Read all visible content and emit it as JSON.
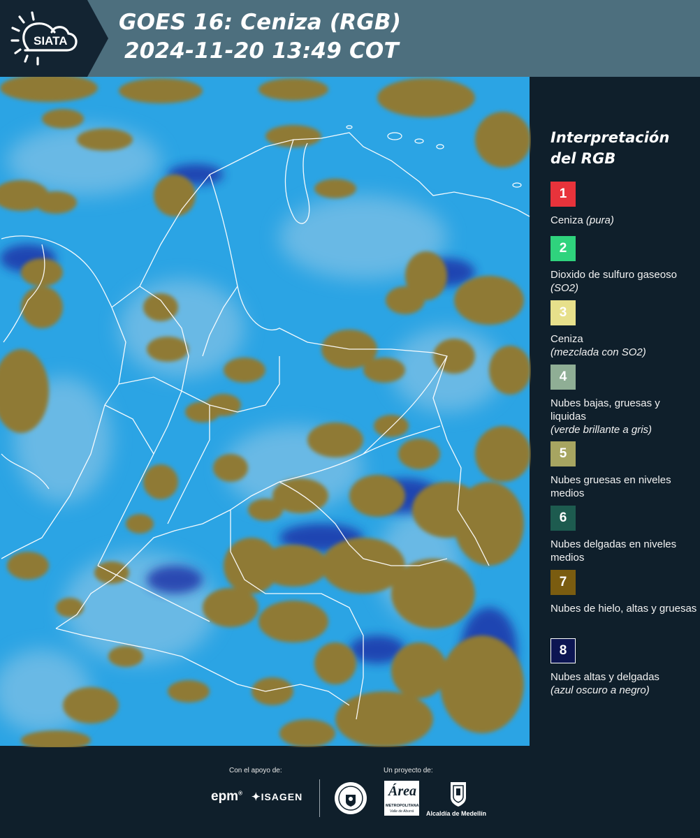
{
  "header": {
    "logo_text": "SIATA",
    "title_line1": "GOES 16: Ceniza (RGB)",
    "title_line2": "2024-11-20 13:49 COT"
  },
  "legend": {
    "title_line1": "Interpretación",
    "title_line2": "del RGB",
    "items": [
      {
        "number": "1",
        "color": "#e8333b",
        "text": "Ceniza",
        "italic": " (pura)"
      },
      {
        "number": "2",
        "color": "#2fd37d",
        "text": "Dioxido de sulfuro gaseoso",
        "italic": " (SO2)"
      },
      {
        "number": "3",
        "color": "#e7e08b",
        "text": "Ceniza",
        "italic": "(mezclada con SO2)"
      },
      {
        "number": "4",
        "color": "#8fae95",
        "text": "Nubes bajas, gruesas y liquidas",
        "italic": "(verde brillante a gris)"
      },
      {
        "number": "5",
        "color": "#a7a561",
        "text": "Nubes gruesas en niveles medios",
        "italic": ""
      },
      {
        "number": "6",
        "color": "#1d5b4f",
        "text": "Nubes delgadas en niveles medios",
        "italic": ""
      },
      {
        "number": "7",
        "color": "#7a5c10",
        "text": "Nubes de hielo, altas y gruesas",
        "italic": ""
      },
      {
        "number": "8",
        "color": "#0c1552",
        "text": "Nubes altas y delgadas",
        "italic": "(azul oscuro a negro)"
      }
    ]
  },
  "footer": {
    "support_label": "Con el apoyo de:",
    "project_label": "Un proyecto de:",
    "epm_logo": "epm",
    "isagen_logo": "ISAGEN",
    "area_logo": "Área",
    "area_logo_sub1": "METROPOLITANA",
    "area_logo_sub2": "Valle de Aburrá",
    "alcaldia_logo": "Alcaldía de Medellín"
  },
  "colors": {
    "header_bg": "#4d6f7e",
    "panel_bg": "#0f1f2b",
    "map_sky": "#2aa5e6",
    "map_cloud": "#8f7a35"
  }
}
